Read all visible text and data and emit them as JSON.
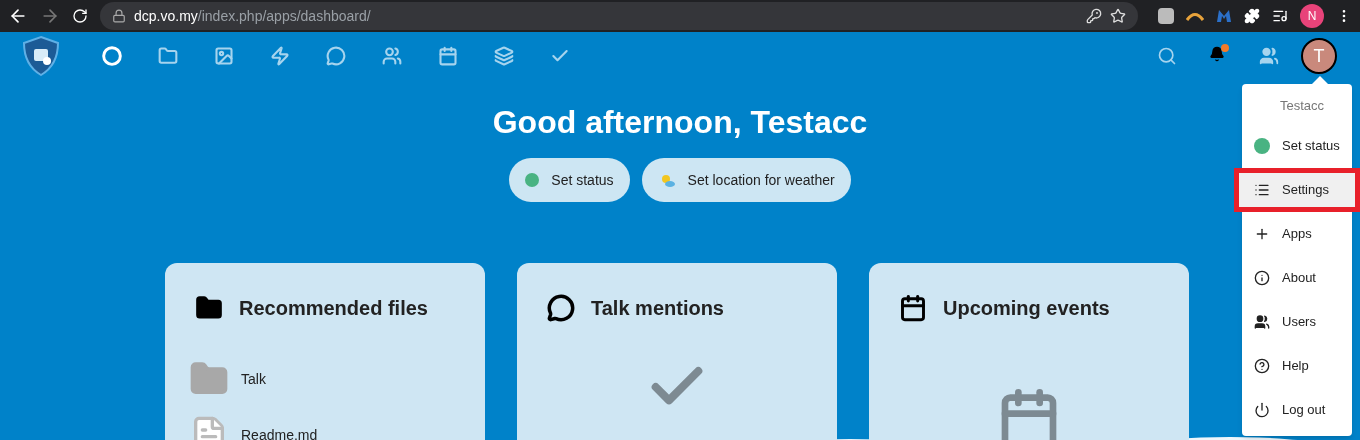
{
  "browser": {
    "url_host": "dcp.vo.my",
    "url_path": "/index.php/apps/dashboard/",
    "profile_initial": "N"
  },
  "header": {
    "apps": [
      {
        "selected": true
      },
      {
        "selected": false
      },
      {
        "selected": false
      },
      {
        "selected": false
      },
      {
        "selected": false
      },
      {
        "selected": false
      },
      {
        "selected": false
      },
      {
        "selected": false
      },
      {
        "selected": false
      }
    ],
    "notifications_unread": true,
    "avatar_initial": "T"
  },
  "greeting": "Good afternoon, Testacc",
  "status_buttons": [
    {
      "kind": "status",
      "label": "Set status",
      "color": "#49b382"
    },
    {
      "kind": "weather",
      "label": "Set location for weather"
    }
  ],
  "panels": [
    {
      "kind": "files",
      "title": "Recommended files",
      "items": [
        {
          "kind": "folder",
          "name": "Talk"
        },
        {
          "kind": "document",
          "name": "Readme.md"
        }
      ]
    },
    {
      "kind": "talk",
      "title": "Talk mentions"
    },
    {
      "kind": "events",
      "title": "Upcoming events"
    }
  ],
  "user_menu": {
    "name": "Testacc",
    "items": [
      {
        "kind": "status",
        "label": "Set status",
        "selected": false,
        "color": "#49b382"
      },
      {
        "kind": "settings",
        "label": "Settings",
        "selected": true
      },
      {
        "kind": "apps",
        "label": "Apps",
        "selected": false
      },
      {
        "kind": "about",
        "label": "About",
        "selected": false
      },
      {
        "kind": "users",
        "label": "Users",
        "selected": false
      },
      {
        "kind": "help",
        "label": "Help",
        "selected": false
      },
      {
        "kind": "logout",
        "label": "Log out",
        "selected": false
      }
    ]
  }
}
